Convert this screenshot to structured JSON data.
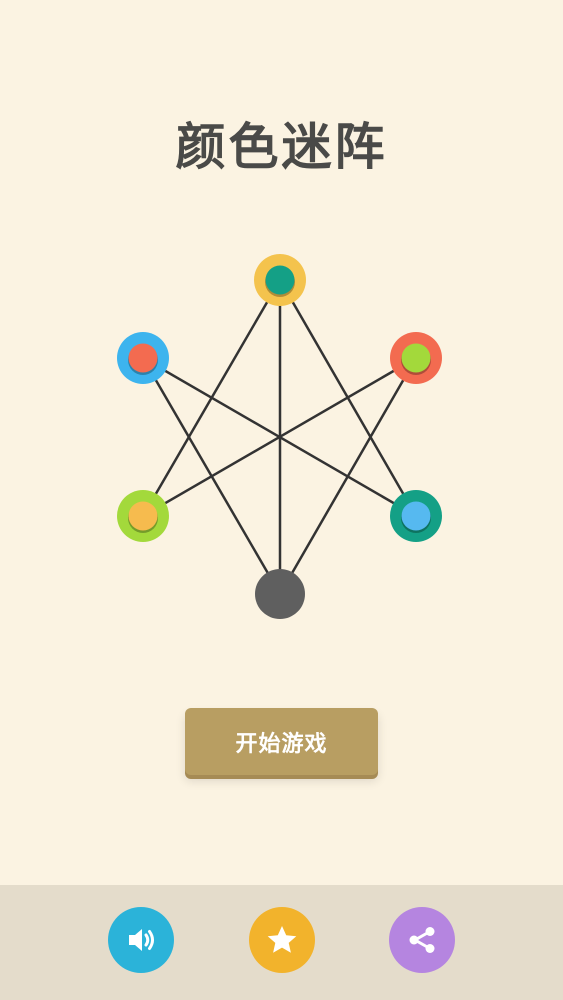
{
  "app": {
    "title": "颜色迷阵"
  },
  "menu": {
    "start_label": "开始游戏"
  },
  "colors": {
    "background": "#fbf3e2",
    "bottom_bar": "#e4dccb",
    "button": "#b89e62",
    "line": "#333333",
    "center_node": "#5f5f5f"
  },
  "puzzle": {
    "nodes": [
      {
        "id": "top",
        "ring_color": "#f4c34d",
        "dot_color": "#14a086"
      },
      {
        "id": "upper-left",
        "ring_color": "#3db4ee",
        "dot_color": "#f36b50"
      },
      {
        "id": "upper-right",
        "ring_color": "#f36b50",
        "dot_color": "#a3d93b"
      },
      {
        "id": "lower-left",
        "ring_color": "#a3d93b",
        "dot_color": "#f6bb4e"
      },
      {
        "id": "lower-right",
        "ring_color": "#14a086",
        "dot_color": "#56b9f0"
      },
      {
        "id": "bottom",
        "ring_color": "#5f5f5f",
        "dot_color": "#5f5f5f"
      }
    ],
    "edges": [
      [
        "top",
        "lower-left"
      ],
      [
        "top",
        "bottom"
      ],
      [
        "top",
        "lower-right"
      ],
      [
        "upper-left",
        "lower-right"
      ],
      [
        "upper-left",
        "bottom"
      ],
      [
        "upper-right",
        "lower-left"
      ],
      [
        "upper-right",
        "bottom"
      ]
    ]
  },
  "bottom_bar": {
    "buttons": [
      {
        "name": "sound",
        "icon": "speaker-icon",
        "color": "#2bb3d9"
      },
      {
        "name": "rate",
        "icon": "star-icon",
        "color": "#f2b32c"
      },
      {
        "name": "share",
        "icon": "share-icon",
        "color": "#b585e0"
      }
    ]
  }
}
